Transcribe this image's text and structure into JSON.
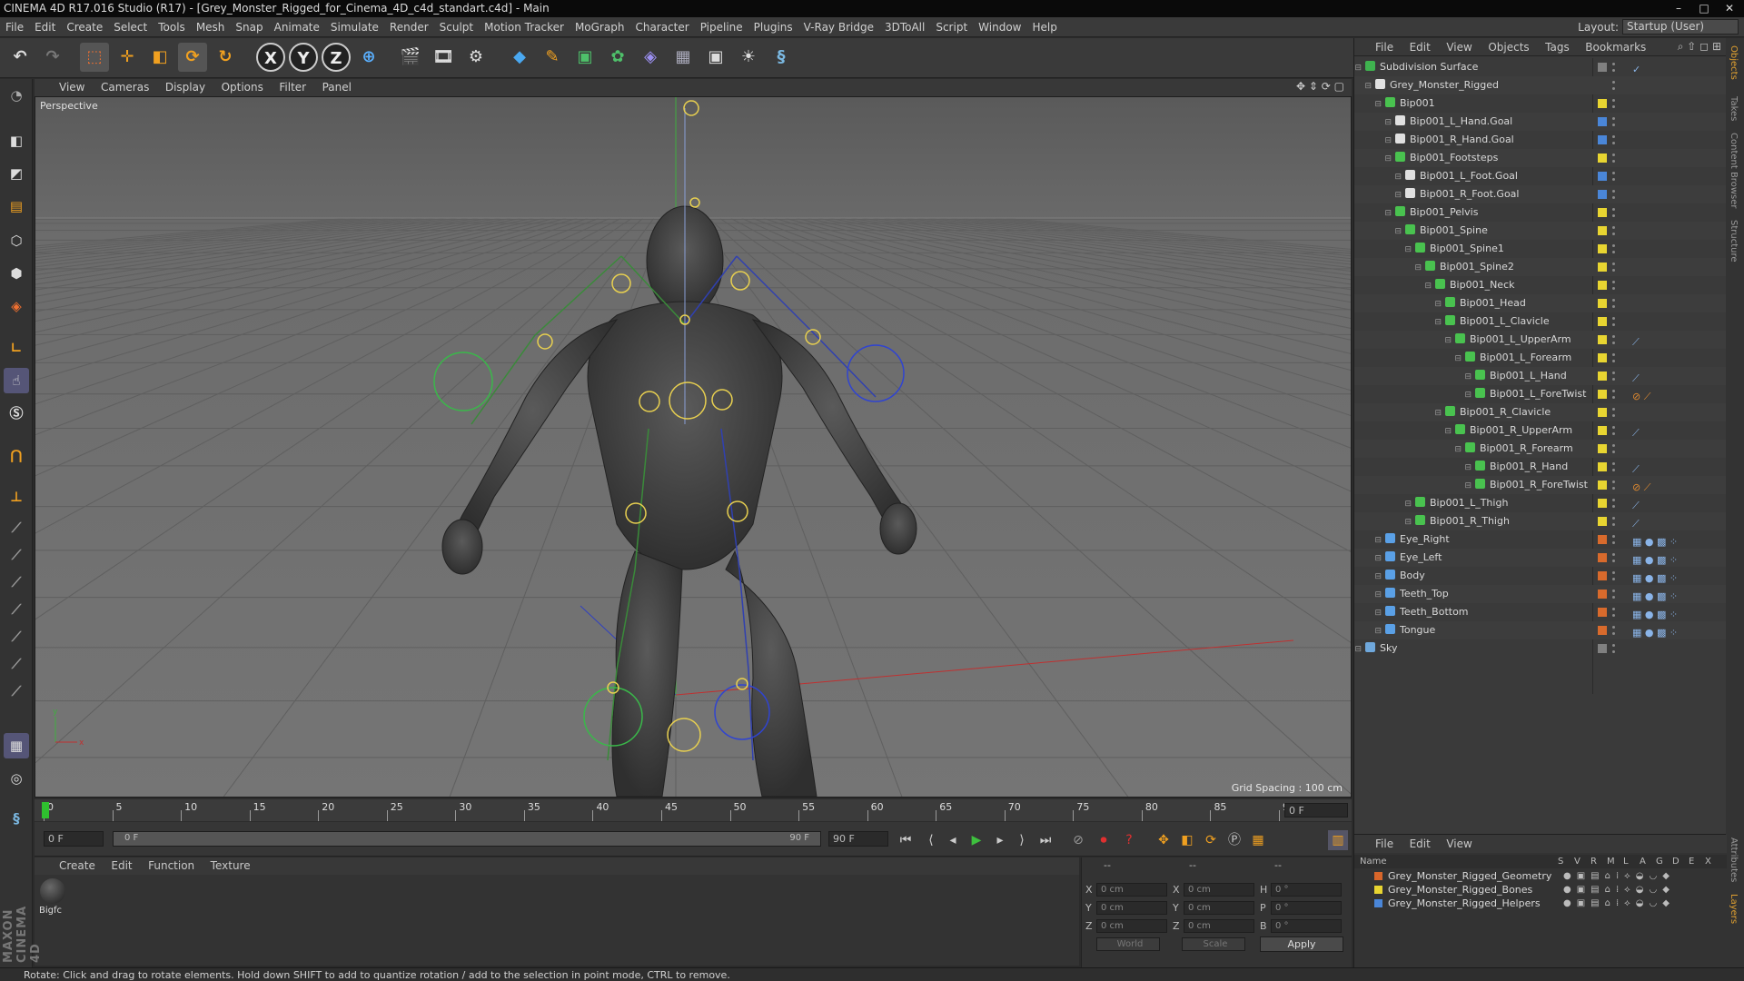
{
  "window": {
    "title": "CINEMA 4D R17.016 Studio (R17) - [Grey_Monster_Rigged_for_Cinema_4D_c4d_standart.c4d] - Main",
    "controls": [
      "–",
      "□",
      "✕"
    ]
  },
  "menubar": {
    "items": [
      "File",
      "Edit",
      "Create",
      "Select",
      "Tools",
      "Mesh",
      "Snap",
      "Animate",
      "Simulate",
      "Render",
      "Sculpt",
      "Motion Tracker",
      "MoGraph",
      "Character",
      "Pipeline",
      "Plugins",
      "V-Ray Bridge",
      "3DToAll",
      "Script",
      "Window",
      "Help"
    ],
    "layout_label": "Layout:",
    "layout_value": "Startup (User)"
  },
  "toolbar": {
    "icons": [
      "undo-icon",
      "redo-icon",
      "live-selection-icon",
      "move-icon",
      "scale-icon",
      "rotate-icon",
      "recent-tools-icon",
      "x-axis-icon",
      "y-axis-icon",
      "z-axis-icon",
      "world-coordinates-icon",
      "render-view-icon",
      "render-picture-viewer-icon",
      "render-settings-icon",
      "cube-icon",
      "pen-icon",
      "subdivision-icon",
      "cloner-icon",
      "deformer-icon",
      "floor-icon",
      "camera-icon",
      "light-icon",
      "python-icon"
    ],
    "axis_labels": [
      "X",
      "Y",
      "Z"
    ]
  },
  "viewport": {
    "menu": [
      "View",
      "Cameras",
      "Display",
      "Options",
      "Filter",
      "Panel"
    ],
    "label": "Perspective",
    "grid_spacing": "Grid Spacing : 100 cm",
    "axis_labels": [
      "y",
      "x"
    ]
  },
  "timeline": {
    "ticks": [
      "0",
      "5",
      "10",
      "15",
      "20",
      "25",
      "30",
      "35",
      "40",
      "45",
      "50",
      "55",
      "60",
      "65",
      "70",
      "75",
      "80",
      "85",
      "90"
    ],
    "current_frame": "0 F",
    "start_field": "0 F",
    "range_start": "0 F",
    "range_end": "90 F",
    "end_field": "90 F"
  },
  "material_panel": {
    "menu": [
      "Create",
      "Edit",
      "Function",
      "Texture"
    ],
    "materials": [
      {
        "name": "Bigfc"
      }
    ]
  },
  "coordinates": {
    "header_dashes": [
      "--",
      "--",
      "--"
    ],
    "rows": [
      {
        "a": "X",
        "av": "0 cm",
        "b": "X",
        "bv": "0 cm",
        "c": "H",
        "cv": "0 °"
      },
      {
        "a": "Y",
        "av": "0 cm",
        "b": "Y",
        "bv": "0 cm",
        "c": "P",
        "cv": "0 °"
      },
      {
        "a": "Z",
        "av": "0 cm",
        "b": "Z",
        "bv": "0 cm",
        "c": "B",
        "cv": "0 °"
      }
    ],
    "mode": "World",
    "size_mode": "Scale",
    "apply": "Apply"
  },
  "object_manager": {
    "menu": [
      "File",
      "Edit",
      "View",
      "Objects",
      "Tags",
      "Bookmarks"
    ],
    "objects": [
      {
        "name": "Subdivision Surface",
        "depth": 0,
        "icon": "#3fb34f",
        "swatch": "#808080",
        "tags": "✓"
      },
      {
        "name": "Grey_Monster_Rigged",
        "depth": 1,
        "icon": "#e0e0e0",
        "swatch": "",
        "tags": ""
      },
      {
        "name": "Bip001",
        "depth": 2,
        "icon": "#49c24f",
        "swatch": "#e8d531",
        "tags": ""
      },
      {
        "name": "Bip001_L_Hand.Goal",
        "depth": 3,
        "icon": "#e0e0e0",
        "swatch": "#4a86d8",
        "tags": ""
      },
      {
        "name": "Bip001_R_Hand.Goal",
        "depth": 3,
        "icon": "#e0e0e0",
        "swatch": "#4a86d8",
        "tags": ""
      },
      {
        "name": "Bip001_Footsteps",
        "depth": 3,
        "icon": "#49c24f",
        "swatch": "#e8d531",
        "tags": ""
      },
      {
        "name": "Bip001_L_Foot.Goal",
        "depth": 4,
        "icon": "#e0e0e0",
        "swatch": "#4a86d8",
        "tags": ""
      },
      {
        "name": "Bip001_R_Foot.Goal",
        "depth": 4,
        "icon": "#e0e0e0",
        "swatch": "#4a86d8",
        "tags": ""
      },
      {
        "name": "Bip001_Pelvis",
        "depth": 3,
        "icon": "#49c24f",
        "swatch": "#e8d531",
        "tags": ""
      },
      {
        "name": "Bip001_Spine",
        "depth": 4,
        "icon": "#49c24f",
        "swatch": "#e8d531",
        "tags": ""
      },
      {
        "name": "Bip001_Spine1",
        "depth": 5,
        "icon": "#49c24f",
        "swatch": "#e8d531",
        "tags": ""
      },
      {
        "name": "Bip001_Spine2",
        "depth": 6,
        "icon": "#49c24f",
        "swatch": "#e8d531",
        "tags": ""
      },
      {
        "name": "Bip001_Neck",
        "depth": 7,
        "icon": "#49c24f",
        "swatch": "#e8d531",
        "tags": ""
      },
      {
        "name": "Bip001_Head",
        "depth": 8,
        "icon": "#49c24f",
        "swatch": "#e8d531",
        "tags": ""
      },
      {
        "name": "Bip001_L_Clavicle",
        "depth": 8,
        "icon": "#49c24f",
        "swatch": "#e8d531",
        "tags": ""
      },
      {
        "name": "Bip001_L_UpperArm",
        "depth": 9,
        "icon": "#49c24f",
        "swatch": "#e8d531",
        "tags": "⟋"
      },
      {
        "name": "Bip001_L_Forearm",
        "depth": 10,
        "icon": "#49c24f",
        "swatch": "#e8d531",
        "tags": ""
      },
      {
        "name": "Bip001_L_Hand",
        "depth": 11,
        "icon": "#49c24f",
        "swatch": "#e8d531",
        "tags": "⟋"
      },
      {
        "name": "Bip001_L_ForeTwist",
        "depth": 11,
        "icon": "#49c24f",
        "swatch": "#e8d531",
        "tags": "⊘ ⟋"
      },
      {
        "name": "Bip001_R_Clavicle",
        "depth": 8,
        "icon": "#49c24f",
        "swatch": "#e8d531",
        "tags": ""
      },
      {
        "name": "Bip001_R_UpperArm",
        "depth": 9,
        "icon": "#49c24f",
        "swatch": "#e8d531",
        "tags": "⟋"
      },
      {
        "name": "Bip001_R_Forearm",
        "depth": 10,
        "icon": "#49c24f",
        "swatch": "#e8d531",
        "tags": ""
      },
      {
        "name": "Bip001_R_Hand",
        "depth": 11,
        "icon": "#49c24f",
        "swatch": "#e8d531",
        "tags": "⟋"
      },
      {
        "name": "Bip001_R_ForeTwist",
        "depth": 11,
        "icon": "#49c24f",
        "swatch": "#e8d531",
        "tags": "⊘ ⟋"
      },
      {
        "name": "Bip001_L_Thigh",
        "depth": 5,
        "icon": "#49c24f",
        "swatch": "#e8d531",
        "tags": "⟋"
      },
      {
        "name": "Bip001_R_Thigh",
        "depth": 5,
        "icon": "#49c24f",
        "swatch": "#e8d531",
        "tags": "⟋"
      },
      {
        "name": "Eye_Right",
        "depth": 2,
        "icon": "#5aa0e6",
        "swatch": "#d86a2c",
        "tags": "▦ ● ▩ ⁘"
      },
      {
        "name": "Eye_Left",
        "depth": 2,
        "icon": "#5aa0e6",
        "swatch": "#d86a2c",
        "tags": "▦ ● ▩ ⁘"
      },
      {
        "name": "Body",
        "depth": 2,
        "icon": "#5aa0e6",
        "swatch": "#d86a2c",
        "tags": "▦ ● ▩ ⁘"
      },
      {
        "name": "Teeth_Top",
        "depth": 2,
        "icon": "#5aa0e6",
        "swatch": "#d86a2c",
        "tags": "▦ ● ▩ ⁘"
      },
      {
        "name": "Teeth_Bottom",
        "depth": 2,
        "icon": "#5aa0e6",
        "swatch": "#d86a2c",
        "tags": "▦ ● ▩ ⁘"
      },
      {
        "name": "Tongue",
        "depth": 2,
        "icon": "#5aa0e6",
        "swatch": "#d86a2c",
        "tags": "▦ ● ▩ ⁘"
      },
      {
        "name": "Sky",
        "depth": 0,
        "icon": "#6fa8dc",
        "swatch": "#808080",
        "tags": ""
      }
    ]
  },
  "side_tabs": [
    "Objects",
    "Takes",
    "Content Browser",
    "Structure",
    "Attributes",
    "Layers"
  ],
  "layer_manager": {
    "menu": [
      "File",
      "Edit",
      "View"
    ],
    "columns": [
      "Name",
      "S",
      "V",
      "R",
      "M",
      "L",
      "A",
      "G",
      "D",
      "E",
      "X"
    ],
    "layers": [
      {
        "name": "Grey_Monster_Rigged_Geometry",
        "color": "#d8662a"
      },
      {
        "name": "Grey_Monster_Rigged_Bones",
        "color": "#e8d531"
      },
      {
        "name": "Grey_Monster_Rigged_Helpers",
        "color": "#4a86d8"
      }
    ]
  },
  "status": "Rotate: Click and drag to rotate elements. Hold down SHIFT to add to quantize rotation / add to the selection in point mode, CTRL to remove.",
  "brand": "MAXON CINEMA 4D"
}
